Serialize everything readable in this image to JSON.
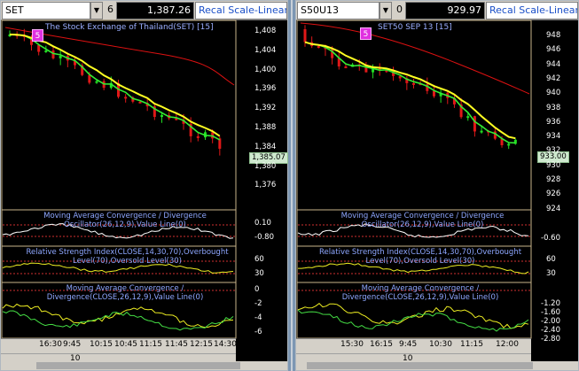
{
  "left": {
    "symbol": "SET",
    "period": "6",
    "price": "1,387.26",
    "recal": "Recal Scale-Linear",
    "marker": "5",
    "chart_title": "The Stock Exchange of Thailand(SET) [15]",
    "last_price_tag": "1,385.07",
    "price_axis": [
      "1,408",
      "1,404",
      "1,400",
      "1,396",
      "1,392",
      "1,388",
      "1,384",
      "1,380",
      "1,376"
    ],
    "macd_title": "Moving Average Convergence / Divergence\nOscillator(26,12,9),Value Line(0)",
    "macd_axis": [
      "0.10",
      "-0.80"
    ],
    "rsi_title": "Relative Strength Index(CLOSE,14,30,70),Overbought\nLevel(70),Oversold Level(30)",
    "rsi_axis": [
      "60",
      "30"
    ],
    "macd2_title": "Moving Average Convergence /\nDivergence(CLOSE,26,12,9),Value Line(0)",
    "macd2_axis": [
      "0",
      "-2",
      "-4",
      "-6"
    ],
    "time_ticks": [
      "16:30",
      "9:45",
      "10:15",
      "10:45",
      "11:15",
      "11:45",
      "12:15",
      "14:30"
    ],
    "date_label": "10"
  },
  "right": {
    "symbol": "S50U13",
    "period": "0",
    "price": "929.97",
    "recal": "Recal Scale-Linear",
    "marker": "5",
    "chart_title": "SET50 SEP 13   [15]",
    "last_price_tag": "933.00",
    "price_axis": [
      "948",
      "946",
      "944",
      "942",
      "940",
      "938",
      "936",
      "934",
      "932",
      "930",
      "928",
      "926",
      "924"
    ],
    "macd_title": "Moving Average Convergence / Divergence\nOscillator(26,12,9),Value Line(0)",
    "macd_axis": [
      "-0.60"
    ],
    "rsi_title": "Relative Strength Index(CLOSE,14,30,70),Overbought\nLevel(70),Oversold Level(30)",
    "rsi_axis": [
      "60",
      "30"
    ],
    "macd2_title": "Moving Average Convergence /\nDivergence(CLOSE,26,12,9),Value Line(0)",
    "macd2_axis": [
      "-1.20",
      "-1.60",
      "-2.00",
      "-2.40",
      "-2.80"
    ],
    "time_ticks": [
      "15:30",
      "16:15",
      "9:45",
      "10:30",
      "11:15",
      "12:00"
    ],
    "date_label": "10"
  },
  "colors": {
    "bull": "#22dd22",
    "bear": "#e01818",
    "ma_fast": "#ffff22",
    "ma_mid": "#33ee33",
    "ma_slow": "#dd1111",
    "title": "#9aaeff"
  }
}
